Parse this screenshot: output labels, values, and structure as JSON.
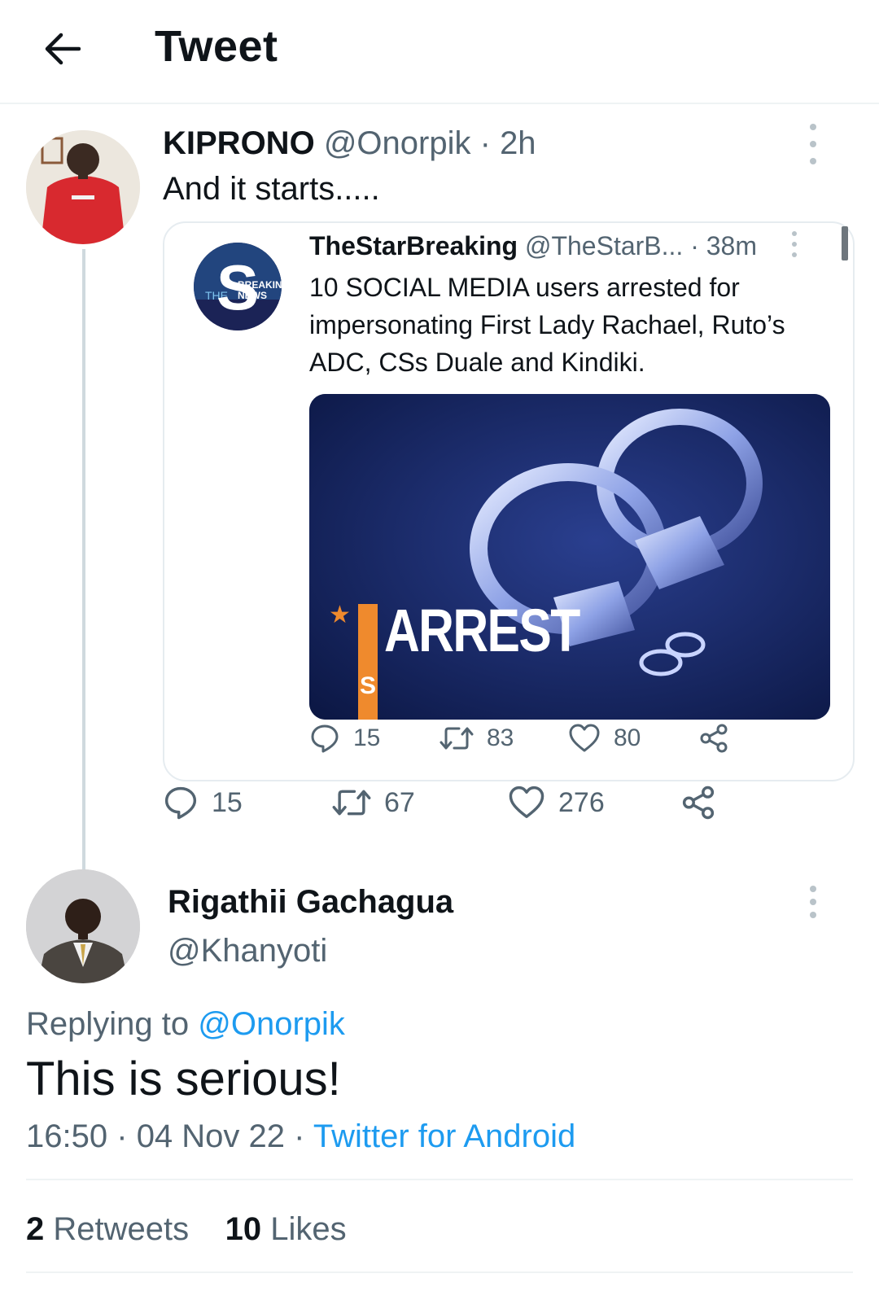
{
  "header": {
    "title": "Tweet"
  },
  "tweet1": {
    "name": "KIPRONO",
    "handle": "@Onorpik",
    "time": "2h",
    "text": "And it starts....."
  },
  "quote": {
    "name": "TheStarBreaking",
    "handle": "@TheStarB...",
    "time": "38m",
    "text": "10 SOCIAL MEDIA users arrested for impersonating First Lady Rachael, Ruto’s ADC, CSs Duale and Kindiki.",
    "media_text": "ARREST",
    "media_letter": "S",
    "avatar_text_1": "BREAKING",
    "avatar_text_2": "NEWS",
    "avatar_text_3": "THE",
    "replies": "15",
    "retweets": "83",
    "likes": "80"
  },
  "tweet1_actions": {
    "replies": "15",
    "retweets": "67",
    "likes": "276"
  },
  "tweet2": {
    "name": "Rigathii Gachagua",
    "handle": "@Khanyoti",
    "replying_prefix": "Replying to ",
    "replying_handle": "@Onorpik",
    "text": "This is serious!",
    "time": "16:50",
    "date": "04 Nov 22",
    "source": "Twitter for Android",
    "retweets_count": "2",
    "retweets_label": "Retweets",
    "likes_count": "10",
    "likes_label": "Likes"
  },
  "separator": "·",
  "icons": {
    "back": "arrow-left-icon",
    "more": "more-vertical-icon",
    "reply": "reply-bubble-icon",
    "retweet": "retweet-icon",
    "like": "heart-icon",
    "share": "share-icon"
  },
  "colors": {
    "link": "#1d9bf0",
    "secondary": "#536471",
    "media_bg": "#0e1c4a",
    "accent_orange": "#ef8a2d"
  }
}
